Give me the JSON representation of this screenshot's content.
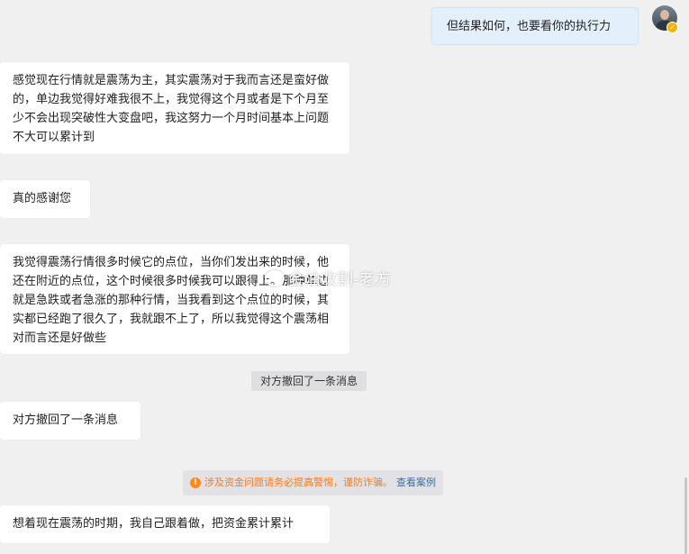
{
  "messages": {
    "outgoing_1": "但结果如何，也要看你的执行力",
    "incoming_1": "感觉现在行情就是震荡为主，其实震荡对于我而言还是蛮好做的，单边我觉得好难我很不上，我觉得这个月或者是下个月至少不会出现突破性大变盘吧，我这努力一个月时间基本上问题不大可以累计到",
    "incoming_2": "真的感谢您",
    "incoming_3": "我觉得震荡行情很多时候它的点位，当你们发出来的时候，他还在附近的点位，这个时候很多时候我可以跟得上。那种单边就是急跌或者急涨的那种行情，当我看到这个点位的时候，其实都已经跑了很久了，我就跟不上了，所以我觉得这个震荡相对而言还是好做些",
    "incoming_4": "对方撤回了一条消息",
    "incoming_5": "想着现在震荡的时期，我自己跟着做，把资金累计累计"
  },
  "system": {
    "recall_notice": "对方撤回了一条消息",
    "warning_text": "涉及资金问题请务必提高警惕，谨防诈骗。",
    "warning_link": "查看案例",
    "warning_icon": "!"
  },
  "watermark": {
    "text": "金油收割-老方"
  },
  "colors": {
    "background": "#f0f0f0",
    "incoming_bubble": "#ffffff",
    "outgoing_bubble": "#e3f0fb",
    "warning_text": "#ff7a1a",
    "link": "#3d6ea8"
  }
}
